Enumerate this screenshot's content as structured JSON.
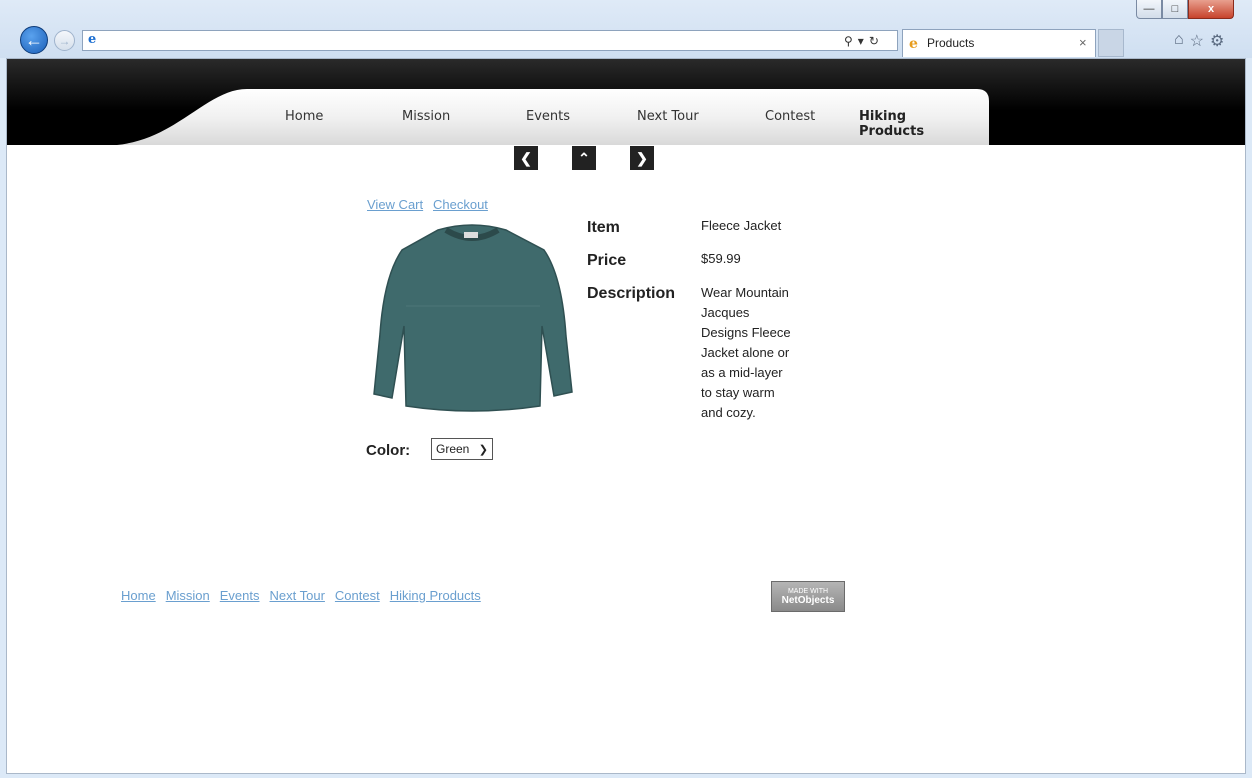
{
  "browser": {
    "tab_title": "Products",
    "window_controls": {
      "minimize": "—",
      "restore": "□",
      "close": "x"
    }
  },
  "nav": {
    "items": [
      {
        "label": "Home"
      },
      {
        "label": "Mission"
      },
      {
        "label": "Events"
      },
      {
        "label": "Next Tour"
      },
      {
        "label": "Contest"
      },
      {
        "label": "Hiking Products"
      }
    ],
    "active": "Hiking Products"
  },
  "pager": {
    "prev_icon": "chevron-left-icon",
    "up_icon": "chevron-up-icon",
    "next_icon": "chevron-right-icon"
  },
  "cart": {
    "view_cart": "View Cart",
    "checkout": "Checkout"
  },
  "product": {
    "item_label": "Item",
    "item_value": "Fleece Jacket",
    "price_label": "Price",
    "price_value": "$59.99",
    "description_label": "Description",
    "description_lines": [
      "Wear Mountain",
      "Jacques",
      "Designs Fleece",
      "Jacket alone or",
      "as a mid-layer",
      "to stay warm",
      "and cozy."
    ],
    "color_label": "Color:",
    "color_selected": "Green",
    "shirt_color": "#3f6a6c"
  },
  "footer": {
    "links": [
      "Home",
      "Mission",
      "Events",
      "Next Tour",
      "Contest",
      "Hiking Products"
    ],
    "badge_top": "MADE WITH",
    "badge_main": "NetObjects"
  }
}
